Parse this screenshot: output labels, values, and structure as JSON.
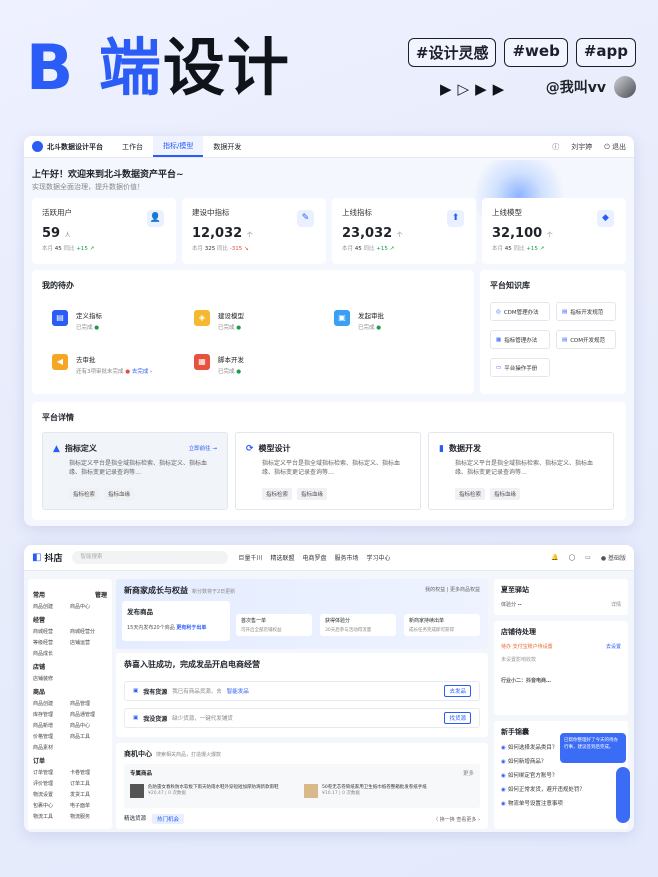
{
  "header": {
    "b": "B",
    "duan": "端",
    "sheji": "设计",
    "tags": [
      "#设计灵感",
      "#web",
      "#app"
    ],
    "arrows": "▶▷▶▶",
    "author": "@我叫vv"
  },
  "platform": {
    "logo": "北斗数据设计平台",
    "nav": [
      "工作台",
      "指标/模型",
      "数据开发"
    ],
    "user": "刘宇婷",
    "logout": "退出",
    "greeting": "上午好！欢迎来到北斗数据资产平台~",
    "greeting_sub": "实现数据全面治理，提升数据价值！",
    "stats": [
      {
        "title": "活跃用户",
        "value": "59",
        "unit": "人",
        "month_label": "本月",
        "month": "45",
        "yoy_label": "同比",
        "yoy": "+15 ↗",
        "dir": "up"
      },
      {
        "title": "建设中指标",
        "value": "12,032",
        "unit": "个",
        "month_label": "本月",
        "month": "325",
        "yoy_label": "同比",
        "yoy": "-315 ↘",
        "dir": "dn"
      },
      {
        "title": "上线指标",
        "value": "23,032",
        "unit": "个",
        "month_label": "本月",
        "month": "45",
        "yoy_label": "同比",
        "yoy": "+15 ↗",
        "dir": "up"
      },
      {
        "title": "上线模型",
        "value": "32,100",
        "unit": "个",
        "month_label": "本月",
        "month": "45",
        "yoy_label": "同比",
        "yoy": "+15 ↗",
        "dir": "up"
      }
    ],
    "todo_title": "我的待办",
    "todos": [
      {
        "label": "定义指标",
        "status": "已完成"
      },
      {
        "label": "建设模型",
        "status": "已完成"
      },
      {
        "label": "发起审批",
        "status": "已完成"
      },
      {
        "label": "去审批",
        "status": "还有3项审批未完成",
        "link": "去完成 ›"
      },
      {
        "label": "脚本开发",
        "status": "已完成"
      }
    ],
    "kb_title": "平台知识库",
    "kb": [
      "CDM管理办法",
      "指标开发规范",
      "指标管理办法",
      "CDM开发规范",
      "平台操作手册"
    ],
    "detail_title": "平台详情",
    "details": [
      {
        "title": "指标定义",
        "go": "立即前往 →",
        "desc": "指标定义平台是指全域指标检索、指标定义、指标血缘、指标变更记录查询等…",
        "chips": [
          "指标检索",
          "指标血缘"
        ]
      },
      {
        "title": "模型设计",
        "desc": "指标定义平台是指全域指标检索、指标定义、指标血缘、指标变更记录查询等…",
        "chips": [
          "指标检索",
          "指标血缘"
        ]
      },
      {
        "title": "数据开发",
        "desc": "指标定义平台是指全域指标检索、指标定义、指标血缘、指标变更记录查询等…",
        "chips": [
          "指标检索",
          "指标血缘"
        ]
      }
    ]
  },
  "shop": {
    "logo": "抖店",
    "search_placeholder": "   智能搜索",
    "nav": [
      "巨量千川",
      "精选联盟",
      "电商罗盘",
      "服务市场",
      "学习中心"
    ],
    "store": "基础版",
    "side": [
      {
        "h": "常用",
        "extra": "管理",
        "items": [
          "商品创建",
          "商品中心"
        ]
      },
      {
        "h": "经营",
        "items": [
          "商城经营",
          "商城经营分",
          "等级经营",
          "店铺运营",
          "商品成长"
        ]
      },
      {
        "h": "店铺",
        "items": [
          "店铺装修"
        ]
      },
      {
        "h": "商品",
        "items": [
          "商品创建",
          "商品管理",
          "库存管理",
          "商品通管理",
          "商品新增",
          "商品中心",
          "价格管理",
          "商品工具",
          "商品素材"
        ]
      },
      {
        "h": "订单",
        "items": [
          "订单管理",
          "卡卷管理",
          "评价管理",
          "订单工具",
          "物流设置",
          "发货工具",
          "包裹中心",
          "电子面单",
          "物流工具",
          "物流服务"
        ]
      }
    ],
    "growth": {
      "title": "新商家成长与权益",
      "sub": "新分数将于2日更新",
      "right": "我的权益 | 更多商品权益",
      "fb_title": "发布商品",
      "fb_sub": "15天内发布20个商品",
      "fb_link": "更有利于出单",
      "steps": [
        {
          "a": "首次售一单",
          "b": "可开启全部店铺权益"
        },
        {
          "a": "获得体验分",
          "b": "30天后参与活动得流量"
        },
        {
          "a": "新商家持续出单",
          "b": "成长任务完成即可获得"
        }
      ]
    },
    "intro": {
      "title": "恭喜入驻成功，完成发品开启电商经营",
      "opts": [
        {
          "h": "我有货源",
          "d": "我已有商品货源，去",
          "l": "智能发品",
          "btn": "去发品"
        },
        {
          "h": "我没货源",
          "d": "缺少货源，一键代发铺货",
          "btn": "找货源"
        }
      ]
    },
    "biz": {
      "title": "商机中心",
      "sub": "搜索相关商品，打造爆火爆款",
      "box": "专属商品",
      "more": "更多",
      "items": [
        {
          "t": "危防雷女春秋防水软板下雨天防雨水鞋外穿短短加厚防滑新款雨鞋",
          "p": "¥20.47 | 0 次数据"
        },
        {
          "t": "50卷无芯卷筒纸家用卫生纸巾纸卷整箱批发卷纸手纸",
          "p": "¥10.17 | 0 次数据"
        }
      ],
      "tabs": [
        "精选货源",
        "热门机会"
      ],
      "pager": "〈 换一换      查看更多 ›"
    },
    "right": {
      "station": "夏至驿站",
      "score_label": "体验分",
      "score": "--",
      "detail": "详情",
      "shop_title": "店铺待处理",
      "shop_row": "待办  支付宝账户待设置",
      "shop_row2": "未设置影响收款",
      "go_set": "去设置",
      "helper": "行业小二：抖音电商…",
      "guide": "新手锦囊",
      "guides": [
        "如何选择发品类目？",
        "如何新增商品？",
        "如何绑定官方账号？",
        "如何正常发货，避开违规处罚？",
        "物流单号设置注意事项"
      ],
      "bubble": "已帮你整理好了今天的待办行事，建议签到后完成。"
    }
  }
}
